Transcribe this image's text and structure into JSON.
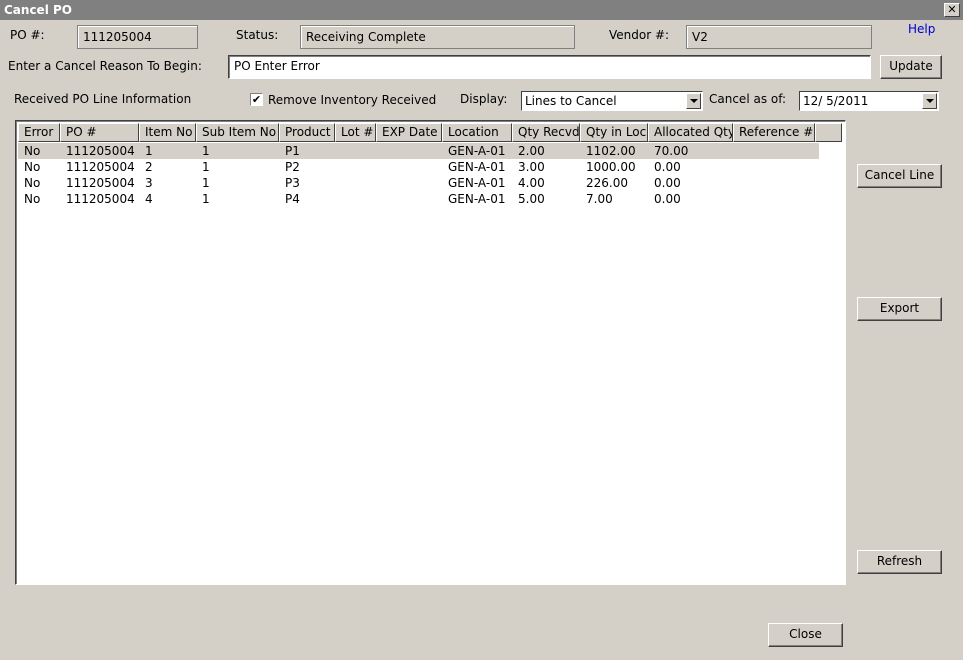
{
  "window": {
    "title": "Cancel PO",
    "close_glyph": "✕"
  },
  "header": {
    "po_label": "PO #:",
    "po_value": "111205004",
    "status_label": "Status:",
    "status_value": "Receiving Complete",
    "vendor_label": "Vendor #:",
    "vendor_value": "V2",
    "help_label": "Help"
  },
  "reason": {
    "label": "Enter a Cancel Reason To Begin:",
    "value": "PO Enter Error",
    "update_label": "Update"
  },
  "options": {
    "section_label": "Received PO Line Information",
    "remove_inventory_label": "Remove Inventory Received",
    "remove_inventory_checked": true,
    "check_glyph": "✔",
    "display_label": "Display:",
    "display_value": "Lines to Cancel",
    "cancel_as_of_label": "Cancel as of:",
    "cancel_as_of_value": "12/  5/2011"
  },
  "table": {
    "columns": [
      "Error",
      "PO #",
      "Item No",
      "Sub Item No",
      "Product",
      "Lot #",
      "EXP Date",
      "Location",
      "Qty Recvd",
      "Qty in Loc",
      "Allocated Qty",
      "Reference #"
    ],
    "rows": [
      [
        "No",
        "111205004",
        "1",
        "1",
        "P1",
        "",
        "",
        "GEN-A-01",
        "2.00",
        "1102.00",
        "70.00",
        ""
      ],
      [
        "No",
        "111205004",
        "2",
        "1",
        "P2",
        "",
        "",
        "GEN-A-01",
        "3.00",
        "1000.00",
        "0.00",
        ""
      ],
      [
        "No",
        "111205004",
        "3",
        "1",
        "P3",
        "",
        "",
        "GEN-A-01",
        "4.00",
        "226.00",
        "0.00",
        ""
      ],
      [
        "No",
        "111205004",
        "4",
        "1",
        "P4",
        "",
        "",
        "GEN-A-01",
        "5.00",
        "7.00",
        "0.00",
        ""
      ]
    ],
    "selected_row": 0
  },
  "actions": {
    "cancel_line_label": "Cancel Line",
    "export_label": "Export",
    "refresh_label": "Refresh",
    "close_label": "Close"
  }
}
